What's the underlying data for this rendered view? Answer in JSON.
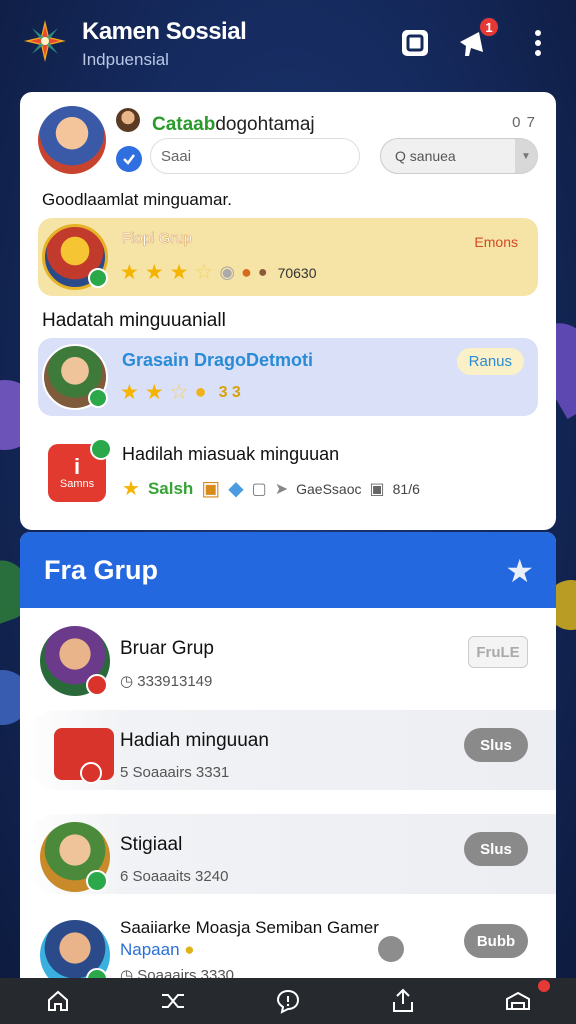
{
  "header": {
    "title": "Kamen Sossial",
    "subtitle": "Indpuensial",
    "notification_count": "1",
    "icons": [
      "app-logo-icon",
      "square-icon",
      "megaphone-icon",
      "more-vert-icon"
    ]
  },
  "profile": {
    "name_highlight": "Cataab",
    "name_rest": "dogohtamaj",
    "count": "0 7",
    "input_value": "Saai",
    "search_value": "Q sanuea"
  },
  "sections": {
    "first_label": "Goodlaamlat minguamar.",
    "second_label": "Hadatah minguuaniall"
  },
  "panel_gold": {
    "title": "Fiopi Grup",
    "right_text": "Emons",
    "stars_filled": 3,
    "stars_total": 4,
    "count_text": "70630"
  },
  "panel_blue": {
    "title": "Grasain DragoDetmoti",
    "button": "Ranus",
    "stars_filled": 2,
    "stars_total": 3,
    "count_text": "3 3"
  },
  "reward_row": {
    "app_big": "i",
    "app_label": "Samns",
    "title": "Hadilah miasuak minguuan",
    "green_word": "Salsh",
    "brand_text": "GaeSsaoc",
    "ratio": "81/6"
  },
  "group_card": {
    "title": "Fra Grup",
    "items": [
      {
        "title": "Bruar Grup",
        "sub": "333913149",
        "button": "FruLE"
      },
      {
        "title": "Hadiah minguuan",
        "sub": "5 Soaaairs 3331",
        "button": "Slus"
      },
      {
        "title": "Stigiaal",
        "sub": "6 Soaaaits 3240",
        "button": "Slus"
      },
      {
        "title": "Saaiiarke Moasja Semiban Gamer",
        "title2": "Napaan",
        "sub": "Soaaairs 3330",
        "button": "Bubb"
      }
    ]
  },
  "bottom_nav": {
    "items": [
      "home-icon",
      "shuffle-icon",
      "chat-alert-icon",
      "share-icon",
      "gift-icon"
    ]
  },
  "colors": {
    "header_bg": "#14285a",
    "accent_blue": "#2468e0",
    "gold_panel": "#f6e3a6",
    "blue_panel": "#d9e0f7",
    "badge_red": "#e53935"
  }
}
